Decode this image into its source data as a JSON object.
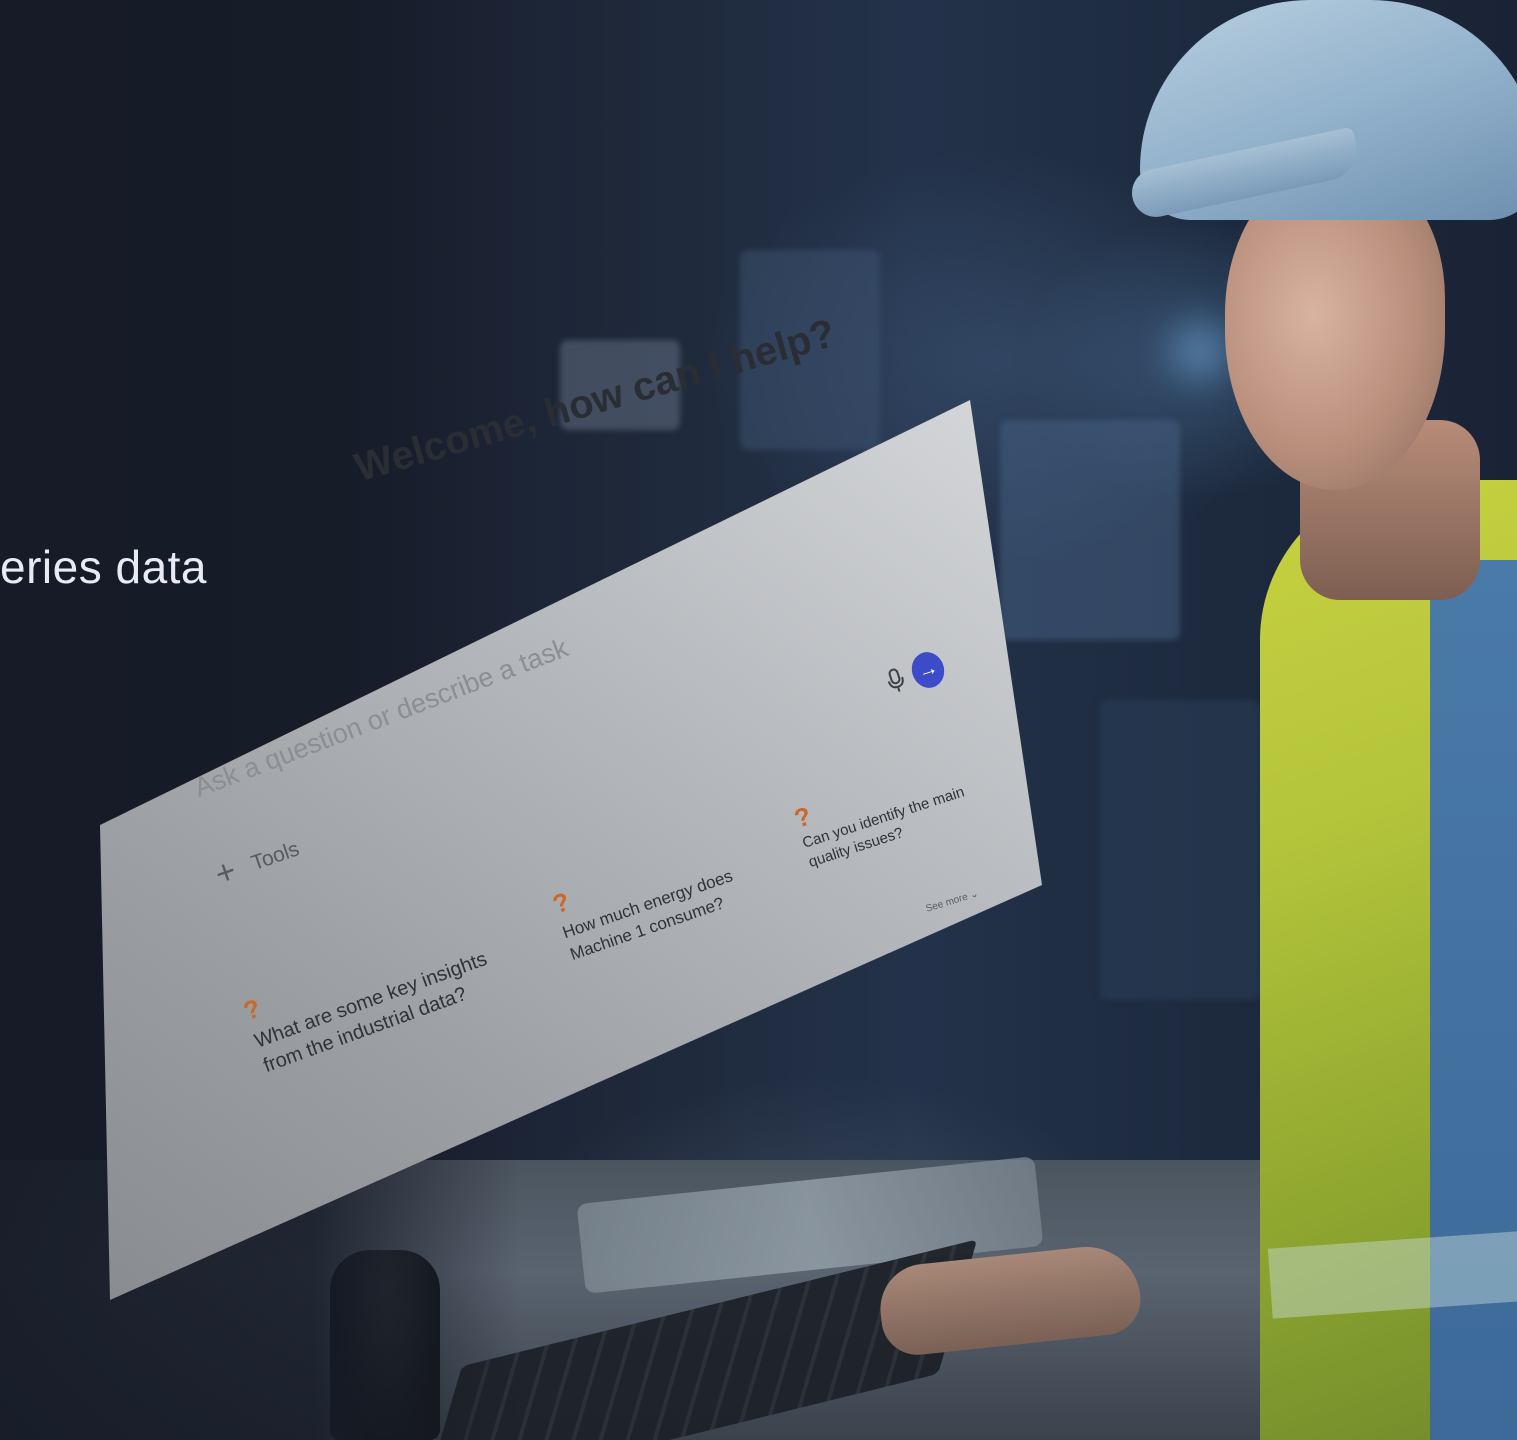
{
  "heading_fragment": "eries data",
  "assistant": {
    "title": "Welcome, how can I help?",
    "input_placeholder": "Ask a question or describe a task",
    "mic_icon": "microphone-icon",
    "send_icon": "arrow-right-icon",
    "tools_label": "Tools",
    "see_more_label": "See more",
    "suggestions": [
      {
        "text": "What are some key insights from the industrial data?"
      },
      {
        "text": "How much energy does Machine 1 consume?"
      },
      {
        "text": "Can you identify the main quality issues?"
      }
    ],
    "accent_color": "#3c4cc9",
    "suggestion_icon_color": "#c96a2c"
  }
}
